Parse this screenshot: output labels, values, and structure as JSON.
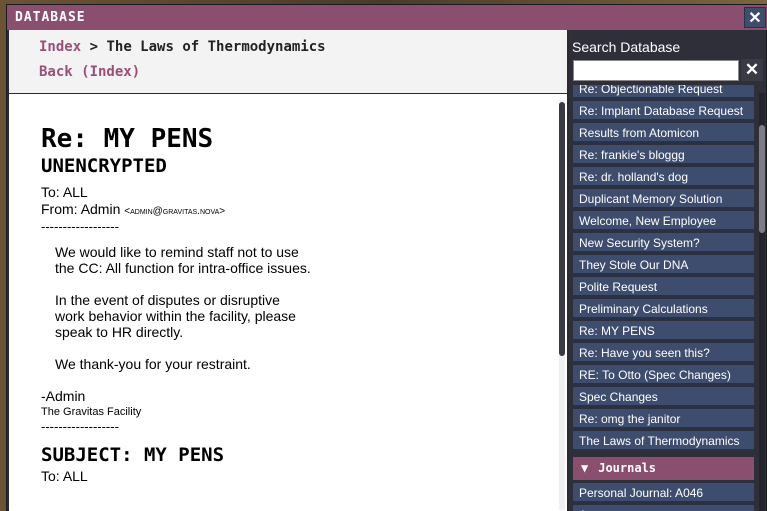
{
  "window": {
    "title": "DATABASE",
    "close_label": "✕"
  },
  "nav": {
    "crumb_link": "Index",
    "crumb_sep": ">",
    "crumb_current": "The Laws of Thermodynamics",
    "back_label": "Back (Index)"
  },
  "document": {
    "title": "Re: MY PENS",
    "status": "UNENCRYPTED",
    "to_label": "To:",
    "to_value": "ALL",
    "from_label": "From:",
    "from_value": "Admin",
    "from_email": "<admin@gravitas.nova>",
    "separator": "------------------",
    "paragraphs": [
      "We would like to remind staff not to use the CC: All function for intra-office issues.",
      "In the event of disputes or disruptive work behavior within the facility, please speak to HR directly.",
      "We thank-you for your restraint."
    ],
    "signoff": "-Admin",
    "facility": "The Gravitas Facility",
    "separator2": "------------------",
    "subject": "SUBJECT: MY PENS",
    "to_label2": "To:",
    "to_value2": "ALL"
  },
  "sidebar": {
    "search_label": "Search Database",
    "search_value": "",
    "clear_label": "✕",
    "entries": [
      "Re: Objectionable Request",
      "Re: Implant Database Request",
      "Results from Atomicon",
      "Re: frankie's bloggg",
      "Re: dr. holland's dog",
      "Duplicant Memory Solution",
      "Welcome, New Employee",
      "New Security System?",
      "They Stole Our DNA",
      "Polite Request",
      "Preliminary Calculations",
      "Re: MY PENS",
      "Re: Have you seen this?",
      "RE: To Otto (Spec Changes)",
      "Spec Changes",
      "Re: omg the janitor",
      "The Laws of Thermodynamics"
    ],
    "section_arrow": "▼",
    "section_label": "Journals",
    "journal_entries": [
      "Personal Journal: A046",
      "A"
    ]
  },
  "colors": {
    "accent": "#8a4f6e",
    "entry_bg": "#3e4c6e",
    "panel_bg": "#2f2f3a"
  }
}
